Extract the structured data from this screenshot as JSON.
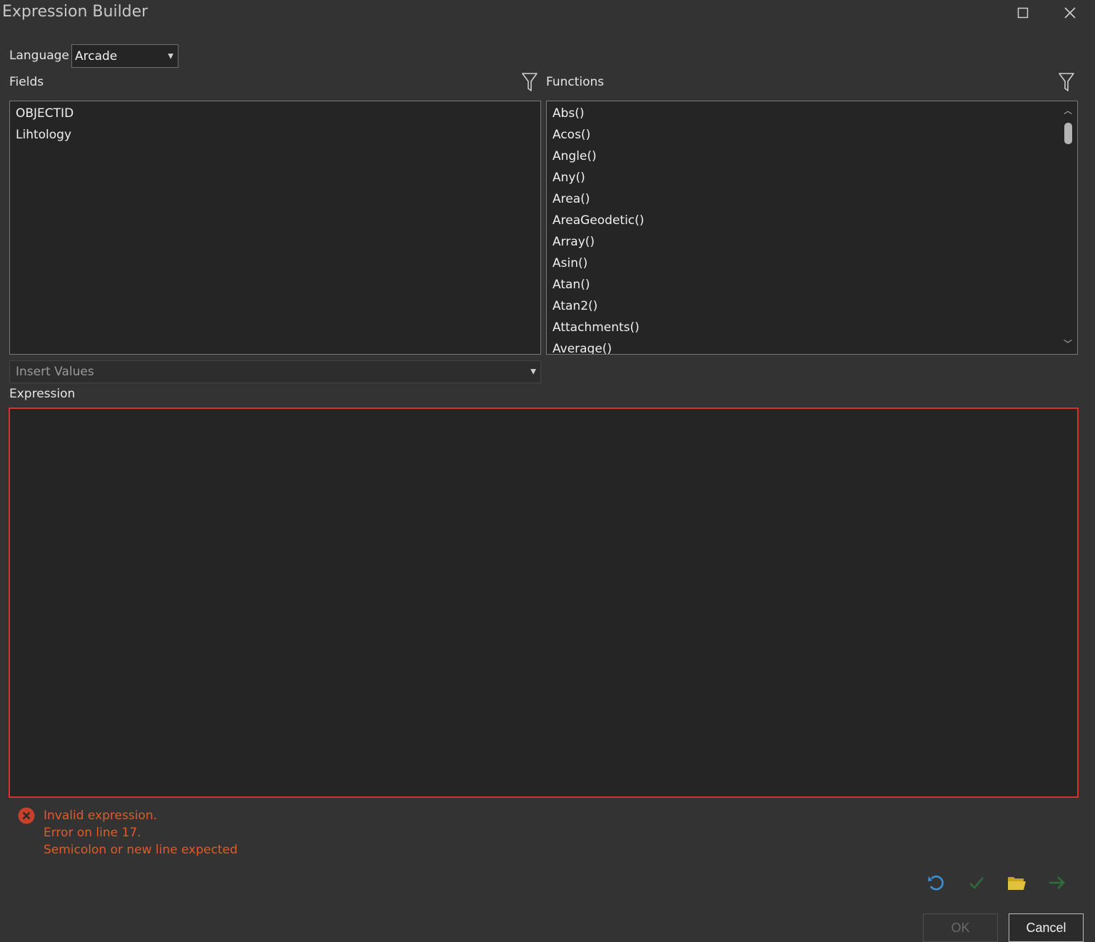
{
  "window": {
    "title": "Expression Builder"
  },
  "language": {
    "label": "Language",
    "selected": "Arcade"
  },
  "fields": {
    "label": "Fields",
    "items": [
      "OBJECTID",
      "Lihtology"
    ]
  },
  "functions": {
    "label": "Functions",
    "items": [
      "Abs()",
      "Acos()",
      "Angle()",
      "Any()",
      "Area()",
      "AreaGeodetic()",
      "Array()",
      "Asin()",
      "Atan()",
      "Atan2()",
      "Attachments()",
      "Average()"
    ]
  },
  "insert_values": {
    "placeholder": "Insert Values"
  },
  "expression": {
    "label": "Expression",
    "value": ""
  },
  "error": {
    "line1": "Invalid expression.",
    "line2": "Error on line 17.",
    "line3": "Semicolon or new line expected"
  },
  "buttons": {
    "ok": "OK",
    "cancel": "Cancel"
  },
  "colors": {
    "error": "#e05a2a",
    "expression_border": "#d9302a",
    "reset_icon": "#3d8fd6",
    "verify_icon": "#2f6b3a",
    "open_icon": "#d9b72a",
    "run_icon": "#2f6b3a"
  },
  "icons": [
    "maximize-icon",
    "close-icon",
    "filter-icon",
    "error-icon",
    "reset-icon",
    "checkmark-icon",
    "folder-open-icon",
    "arrow-right-icon"
  ]
}
